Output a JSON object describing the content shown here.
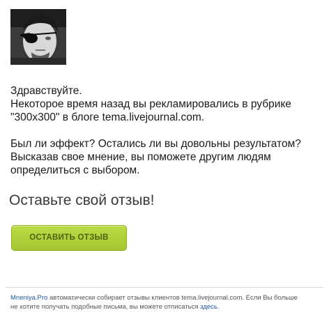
{
  "message": {
    "greeting": "Здравствуйте.",
    "line1": "Некоторое время назад вы рекламировались в рубрике",
    "line2": "\"300x300\" в блоге tema.livejournal.com.",
    "line3": "Был ли эффект? Остались ли вы довольны результатом?",
    "line4": "Высказав свое мнение, вы поможете другим людям",
    "line5": "определиться с выбором."
  },
  "heading": "Оставьте свой отзыв!",
  "cta": {
    "label": "ОСТАВИТЬ ОТЗЫВ"
  },
  "footer": {
    "brand": "Mneniya.Pro",
    "text1": " автоматически собирает отзывы клиентов tema.livejournal.com. Если Вы больше",
    "text2": "не хотите получать подобные письма, вы можете отписаться ",
    "unsubscribe_link": "здесь",
    "text3": "."
  },
  "colors": {
    "button": "#b1d13c",
    "button_text": "#4e6310",
    "link": "#1e5aa6"
  }
}
